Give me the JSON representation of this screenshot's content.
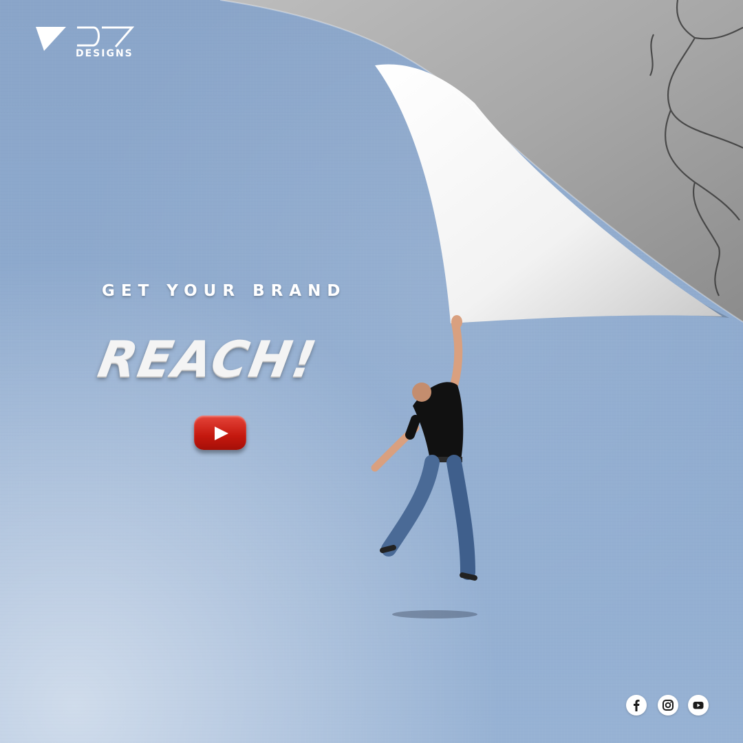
{
  "brand": {
    "logo_icon": "v-triangle-icon",
    "logo_text": "DESIGNS",
    "accent_color": "#ffffff"
  },
  "hero": {
    "tagline": "GET YOUR BRAND",
    "headline": "REACH!"
  },
  "youtube_button": {
    "icon": "youtube-play-icon",
    "color": "#d0211a"
  },
  "background": {
    "paper_color": "#8fabcf",
    "revealed_color": "#9a9a9a"
  },
  "social": [
    {
      "icon": "facebook-icon"
    },
    {
      "icon": "instagram-icon"
    },
    {
      "icon": "youtube-icon"
    }
  ]
}
